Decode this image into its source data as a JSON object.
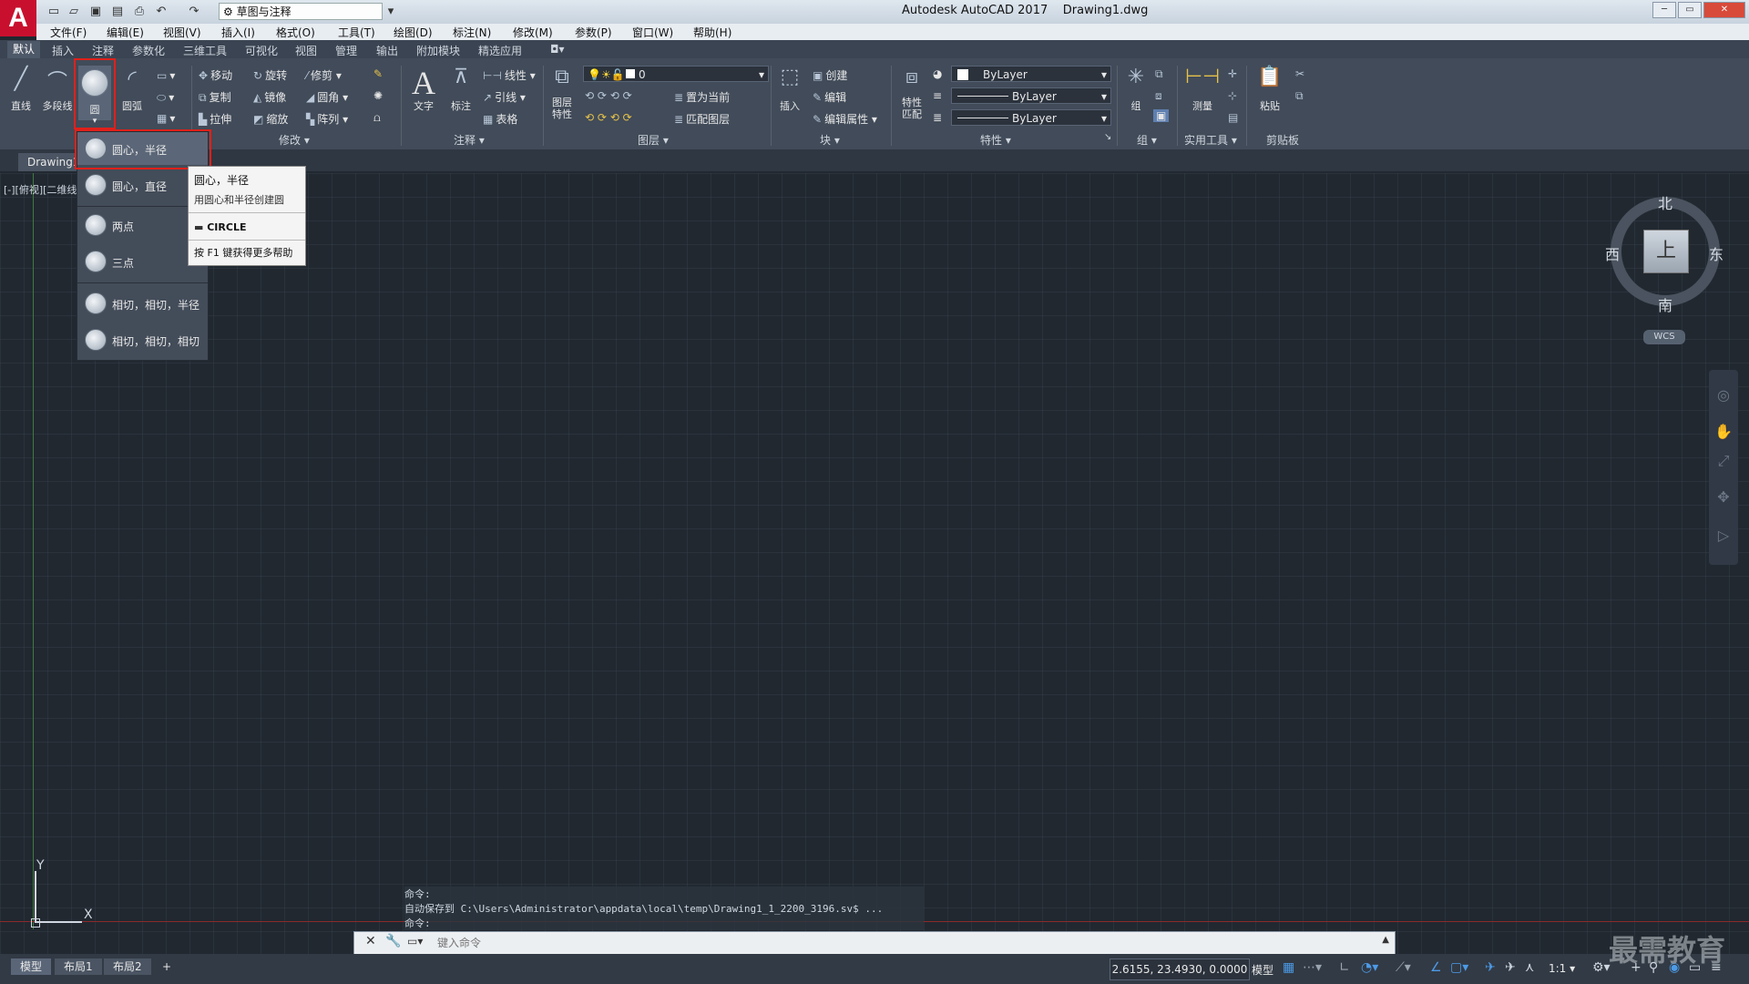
{
  "titlebar": {
    "logo": "A",
    "workspace": "草图与注释",
    "app_title": "Autodesk AutoCAD 2017",
    "file_title": "Drawing1.dwg"
  },
  "menubar": [
    "文件(F)",
    "编辑(E)",
    "视图(V)",
    "插入(I)",
    "格式(O)",
    "工具(T)",
    "绘图(D)",
    "标注(N)",
    "修改(M)",
    "参数(P)",
    "窗口(W)",
    "帮助(H)"
  ],
  "ribbon_tabs": [
    "默认",
    "插入",
    "注释",
    "参数化",
    "三维工具",
    "可视化",
    "视图",
    "管理",
    "输出",
    "附加模块",
    "精选应用"
  ],
  "ribbon": {
    "draw": {
      "line": "直线",
      "polyline": "多段线",
      "circle": "圆",
      "arc": "圆弧"
    },
    "modify": {
      "title": "修改",
      "move": "移动",
      "rotate": "旋转",
      "trim": "修剪",
      "copy": "复制",
      "mirror": "镜像",
      "fillet": "圆角",
      "stretch": "拉伸",
      "scale": "缩放",
      "array": "阵列"
    },
    "annotation": {
      "title": "注释",
      "text": "文字",
      "dimension": "标注",
      "linear": "线性",
      "leader": "引线",
      "table": "表格"
    },
    "layers": {
      "title": "图层",
      "layer_props": "图层\n特性",
      "layer_value": "0",
      "set_current": "置为当前",
      "match_layer": "匹配图层"
    },
    "block": {
      "title": "块",
      "insert": "插入",
      "create": "创建",
      "edit": "编辑",
      "edit_attr": "编辑属性"
    },
    "properties": {
      "title": "特性",
      "match": "特性\n匹配",
      "color": "ByLayer",
      "linetype": "ByLayer",
      "lineweight": "ByLayer"
    },
    "groups": {
      "title": "组",
      "group": "组"
    },
    "utilities": {
      "title": "实用工具",
      "measure": "测量"
    },
    "clipboard": {
      "title": "剪贴板",
      "paste": "粘贴"
    }
  },
  "file_tab": "Drawing1",
  "viewport_label": "[-][俯视][二维线框]",
  "circle_menu": [
    {
      "label": "圆心，半径"
    },
    {
      "label": "圆心，直径"
    },
    {
      "label": "两点"
    },
    {
      "label": "三点"
    },
    {
      "label": "相切，相切，半径"
    },
    {
      "label": "相切，相切，相切"
    }
  ],
  "tooltip": {
    "title": "圆心，半径",
    "description": "用圆心和半径创建圆",
    "command": "CIRCLE",
    "help": "按 F1 键获得更多帮助"
  },
  "viewcube": {
    "north": "北",
    "south": "南",
    "east": "东",
    "west": "西",
    "face": "上",
    "wcs": "WCS"
  },
  "ucs": {
    "x": "X",
    "y": "Y"
  },
  "command": {
    "history": [
      "命令:",
      "自动保存到 C:\\Users\\Administrator\\appdata\\local\\temp\\Drawing1_1_2200_3196.sv$ ...",
      "命令:"
    ],
    "placeholder": "键入命令"
  },
  "statusbar": {
    "layouts": [
      "模型",
      "布局1",
      "布局2"
    ],
    "add": "+",
    "coords": "2.6155, 23.4930, 0.0000",
    "model": "模型",
    "scale": "1:1"
  },
  "watermark": "最需教育",
  "colors": {
    "highlight": "#e0201a",
    "accent": "#4c9be8",
    "logo": "#c8102e"
  }
}
